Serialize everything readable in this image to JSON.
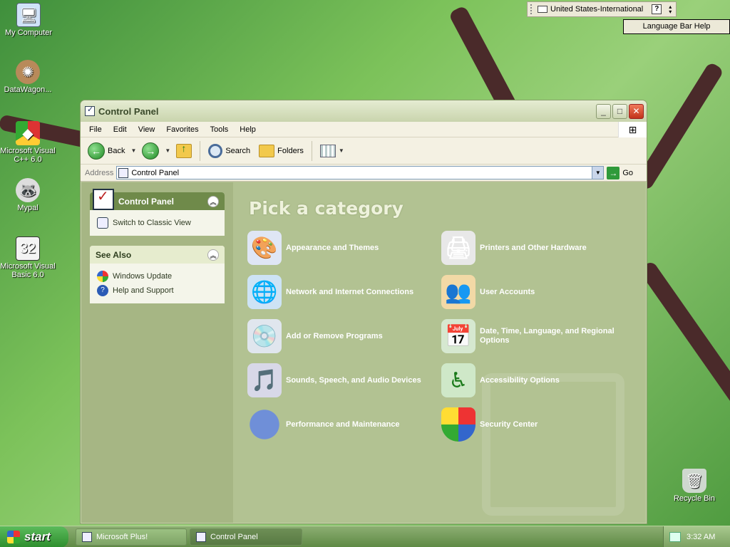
{
  "desktop": {
    "icons": [
      {
        "label": "My Computer",
        "icon": "computer-icon"
      },
      {
        "label": "DataWagon...",
        "icon": "shortcut-icon"
      },
      {
        "label": "Microsoft Visual C++ 6.0",
        "icon": "visual-cpp-icon"
      },
      {
        "label": "Mypal",
        "icon": "mypal-icon"
      },
      {
        "label": "Microsoft Visual Basic 6.0",
        "icon": "visual-basic-icon"
      },
      {
        "label": "Recycle Bin",
        "icon": "recycle-bin-icon"
      }
    ]
  },
  "langbar": {
    "text": "United States-International",
    "help": "?",
    "tooltip": "Language Bar Help"
  },
  "window": {
    "title": "Control Panel",
    "menu": [
      "File",
      "Edit",
      "View",
      "Favorites",
      "Tools",
      "Help"
    ],
    "toolbar": {
      "back": "Back",
      "search": "Search",
      "folders": "Folders"
    },
    "address": {
      "label": "Address",
      "value": "Control Panel",
      "go": "Go"
    },
    "taskpane": {
      "main_title": "Control Panel",
      "switch_link": "Switch to Classic View",
      "see_also_title": "See Also",
      "see_also": [
        "Windows Update",
        "Help and Support"
      ]
    },
    "heading": "Pick a category",
    "categories": [
      "Appearance and Themes",
      "Printers and Other Hardware",
      "Network and Internet Connections",
      "User Accounts",
      "Add or Remove Programs",
      "Date, Time, Language, and Regional Options",
      "Sounds, Speech, and Audio Devices",
      "Accessibility Options",
      "Performance and Maintenance",
      "Security Center"
    ]
  },
  "taskbar": {
    "start": "start",
    "tasks": [
      "Microsoft Plus!",
      "Control Panel"
    ],
    "clock": "3:32 AM"
  }
}
